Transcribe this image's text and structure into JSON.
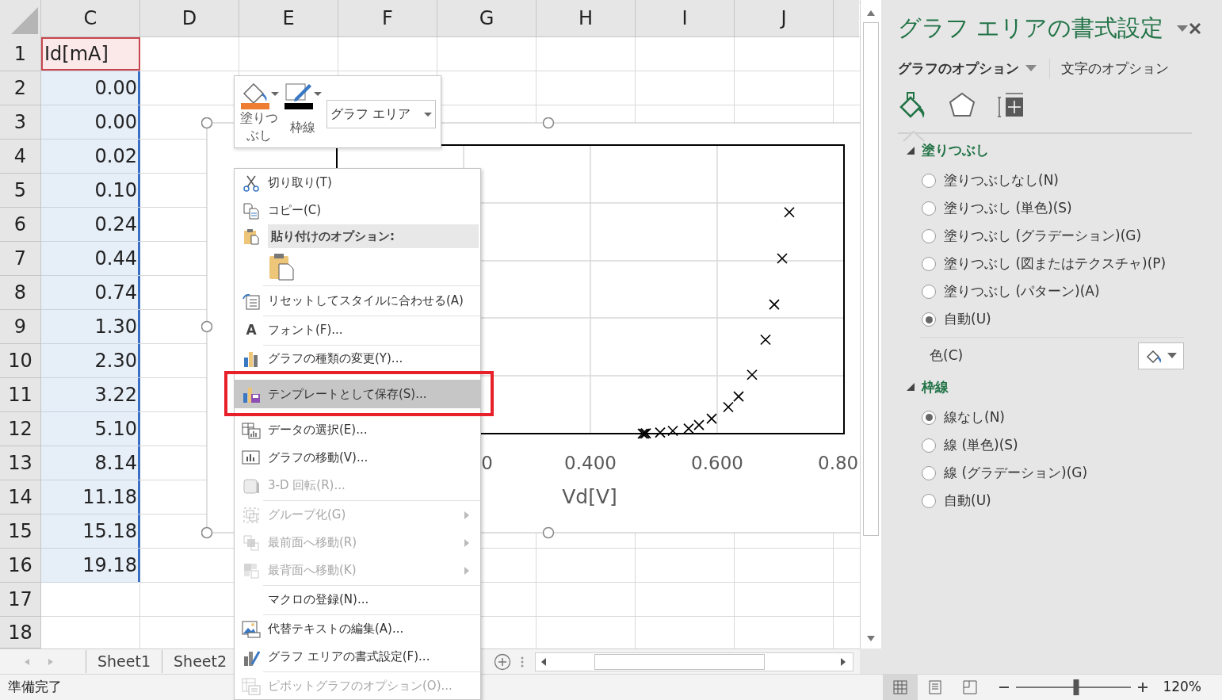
{
  "sheet": {
    "columns": [
      "C",
      "D",
      "E",
      "F",
      "G",
      "H",
      "I",
      "J"
    ],
    "rows": [
      {
        "number": "1",
        "value": "Id[mA]",
        "kind": "name"
      },
      {
        "number": "2",
        "value": "0.00",
        "kind": "values"
      },
      {
        "number": "3",
        "value": "0.00",
        "kind": "values"
      },
      {
        "number": "4",
        "value": "0.02",
        "kind": "values"
      },
      {
        "number": "5",
        "value": "0.10",
        "kind": "values"
      },
      {
        "number": "6",
        "value": "0.24",
        "kind": "values"
      },
      {
        "number": "7",
        "value": "0.44",
        "kind": "values"
      },
      {
        "number": "8",
        "value": "0.74",
        "kind": "values"
      },
      {
        "number": "9",
        "value": "1.30",
        "kind": "values"
      },
      {
        "number": "10",
        "value": "2.30",
        "kind": "values"
      },
      {
        "number": "11",
        "value": "3.22",
        "kind": "values"
      },
      {
        "number": "12",
        "value": "5.10",
        "kind": "values"
      },
      {
        "number": "13",
        "value": "8.14",
        "kind": "values"
      },
      {
        "number": "14",
        "value": "11.18",
        "kind": "values"
      },
      {
        "number": "15",
        "value": "15.18",
        "kind": "values"
      },
      {
        "number": "16",
        "value": "19.18",
        "kind": "values"
      },
      {
        "number": "17"
      },
      {
        "number": "18"
      }
    ]
  },
  "chart": {
    "selected": true,
    "x_tick_labels": [
      "0",
      "0.400",
      "0.600",
      "0.80"
    ],
    "x_title": "Vd[V]"
  },
  "mini_toolbar": {
    "fill_label": "塗りつぶし",
    "outline_label": "枠線",
    "element_select": "グラフ エリア"
  },
  "context_menu": {
    "items": [
      {
        "kind": "command",
        "label": "切り取り(T)",
        "disabled": false,
        "submenu": false,
        "hovered": false,
        "outlined": false
      },
      {
        "kind": "command",
        "label": "コピー(C)",
        "disabled": false,
        "submenu": false,
        "hovered": false,
        "outlined": false
      },
      {
        "kind": "header",
        "label": "貼り付けのオプション:"
      },
      {
        "kind": "paste"
      },
      {
        "kind": "separator"
      },
      {
        "kind": "command",
        "label": "リセットしてスタイルに合わせる(A)",
        "disabled": false,
        "submenu": false,
        "hovered": false,
        "outlined": false
      },
      {
        "kind": "separator"
      },
      {
        "kind": "command",
        "label": "フォント(F)...",
        "icon_glyph": "A",
        "disabled": false,
        "submenu": false,
        "hovered": false,
        "outlined": false
      },
      {
        "kind": "separator"
      },
      {
        "kind": "command",
        "label": "グラフの種類の変更(Y)...",
        "disabled": false,
        "submenu": false,
        "hovered": false,
        "outlined": false
      },
      {
        "kind": "command",
        "label": "テンプレートとして保存(S)...",
        "disabled": false,
        "submenu": false,
        "hovered": true,
        "outlined": true
      },
      {
        "kind": "command",
        "label": "データの選択(E)...",
        "disabled": false,
        "submenu": false,
        "hovered": false,
        "outlined": false
      },
      {
        "kind": "command",
        "label": "グラフの移動(V)...",
        "disabled": false,
        "submenu": false,
        "hovered": false,
        "outlined": false
      },
      {
        "kind": "command",
        "label": "3-D 回転(R)...",
        "disabled": true,
        "submenu": false,
        "hovered": false,
        "outlined": false
      },
      {
        "kind": "separator"
      },
      {
        "kind": "command",
        "label": "グループ化(G)",
        "disabled": true,
        "submenu": true,
        "hovered": false,
        "outlined": false
      },
      {
        "kind": "command",
        "label": "最前面へ移動(R)",
        "disabled": true,
        "submenu": true,
        "hovered": false,
        "outlined": false
      },
      {
        "kind": "command",
        "label": "最背面へ移動(K)",
        "disabled": true,
        "submenu": true,
        "hovered": false,
        "outlined": false
      },
      {
        "kind": "separator"
      },
      {
        "kind": "command",
        "label": "マクロの登録(N)...",
        "disabled": false,
        "submenu": false,
        "hovered": false,
        "outlined": false
      },
      {
        "kind": "separator"
      },
      {
        "kind": "command",
        "label": "代替テキストの編集(A)...",
        "disabled": false,
        "submenu": false,
        "hovered": false,
        "outlined": false
      },
      {
        "kind": "command",
        "label": "グラフ エリアの書式設定(F)...",
        "disabled": false,
        "submenu": false,
        "hovered": false,
        "outlined": false
      },
      {
        "kind": "separator"
      },
      {
        "kind": "command",
        "label": "ピボットグラフのオプション(O)...",
        "disabled": true,
        "submenu": false,
        "hovered": false,
        "outlined": false
      }
    ]
  },
  "format_pane": {
    "title": "グラフ エリアの書式設定",
    "tabs": [
      {
        "label": "グラフのオプション",
        "selected": true
      },
      {
        "label": "文字のオプション",
        "selected": false
      }
    ],
    "icon_tabs": [
      {
        "selected": true
      },
      {
        "selected": false
      },
      {
        "selected": false
      }
    ],
    "sections": [
      {
        "title": "塗りつぶし",
        "expanded": true,
        "options": [
          {
            "label": "塗りつぶしなし(N)",
            "selected": false
          },
          {
            "label": "塗りつぶし (単色)(S)",
            "selected": false
          },
          {
            "label": "塗りつぶし (グラデーション)(G)",
            "selected": false
          },
          {
            "label": "塗りつぶし (図またはテクスチャ)(P)",
            "selected": false
          },
          {
            "label": "塗りつぶし (パターン)(A)",
            "selected": false
          },
          {
            "label": "自動(U)",
            "selected": true
          }
        ],
        "color_label": "色(C)"
      },
      {
        "title": "枠線",
        "expanded": true,
        "options": [
          {
            "label": "線なし(N)",
            "selected": true
          },
          {
            "label": "線 (単色)(S)",
            "selected": false
          },
          {
            "label": "線 (グラデーション)(G)",
            "selected": false
          },
          {
            "label": "自動(U)",
            "selected": false
          }
        ]
      }
    ]
  },
  "sheet_tabs": [
    {
      "label": "Sheet1"
    },
    {
      "label": "Sheet2"
    }
  ],
  "status_bar": {
    "text": "準備完了",
    "views": [
      {
        "selected": true
      },
      {
        "selected": false
      },
      {
        "selected": false
      }
    ],
    "zoom": {
      "level": 0.52,
      "reading": "120%"
    }
  }
}
